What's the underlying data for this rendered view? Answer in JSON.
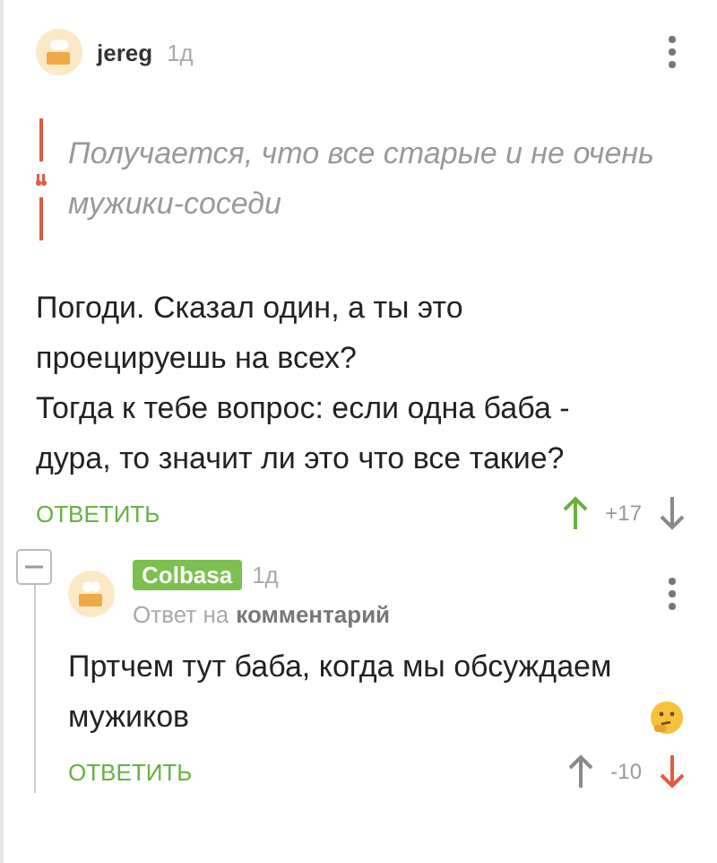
{
  "comment": {
    "author": "jereg",
    "author_highlighted": false,
    "time": "1д",
    "quote": "Получается, что все старые и не очень мужики-соседи",
    "text": [
      "Погоди. Сказал один, а ты это проецируешь на всех?",
      "Тогда к тебе вопрос: если одна баба - дура, то значит ли это что все такие?"
    ],
    "reply": "ОТВЕТИТЬ",
    "rating": "+17",
    "upvoted": true,
    "downvoted": false
  },
  "reply_comment": {
    "author": "Colbasa",
    "author_highlighted": true,
    "time": "1д",
    "reply_prefix": "Ответ на",
    "reply_target": "комментарий",
    "text": "Пртчем тут баба, когда мы обсуждаем мужиков",
    "reply": "ОТВЕТИТЬ",
    "rating": "-10",
    "upvoted": false,
    "downvoted": true
  }
}
